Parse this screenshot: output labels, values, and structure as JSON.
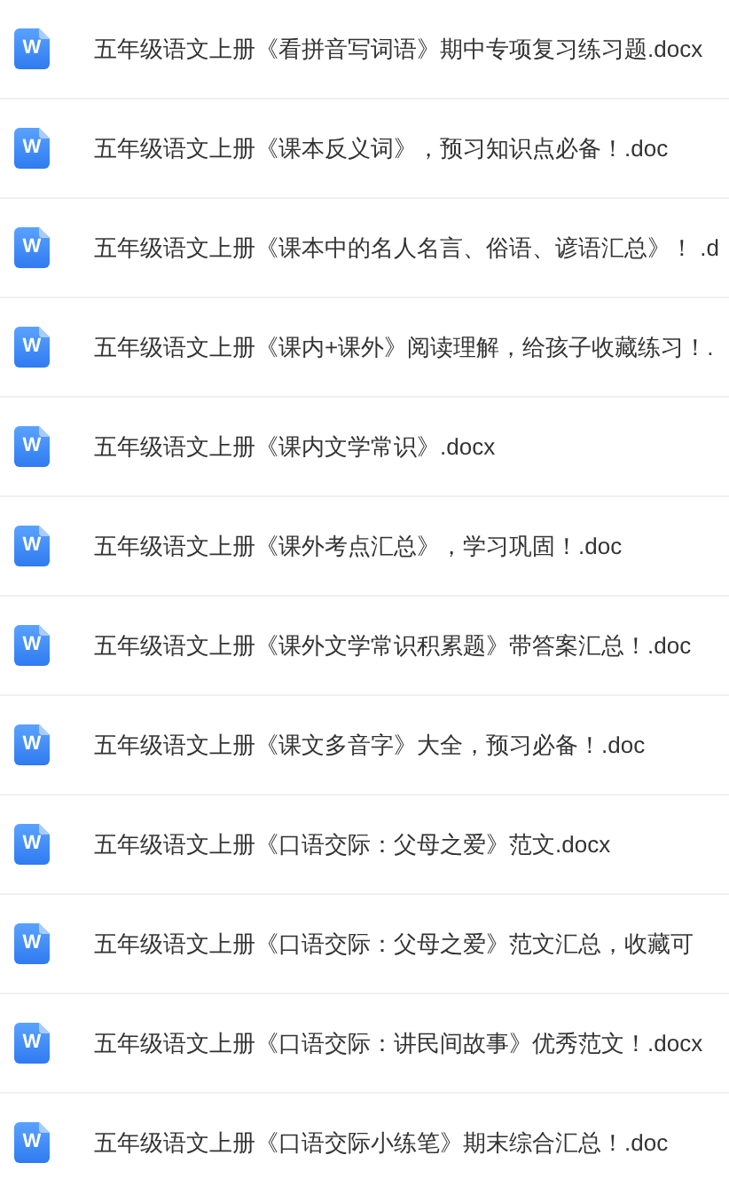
{
  "files": [
    {
      "name": "五年级语文上册《看拼音写词语》期中专项复习练习题.docx",
      "icon_label": "W"
    },
    {
      "name": "五年级语文上册《课本反义词》，预习知识点必备！.doc",
      "icon_label": "W"
    },
    {
      "name": "五年级语文上册《课本中的名人名言、俗语、谚语汇总》！ .d",
      "icon_label": "W"
    },
    {
      "name": "五年级语文上册《课内+课外》阅读理解，给孩子收藏练习！.",
      "icon_label": "W"
    },
    {
      "name": "五年级语文上册《课内文学常识》.docx",
      "icon_label": "W"
    },
    {
      "name": "五年级语文上册《课外考点汇总》，学习巩固！.doc",
      "icon_label": "W"
    },
    {
      "name": "五年级语文上册《课外文学常识积累题》带答案汇总！.doc",
      "icon_label": "W"
    },
    {
      "name": "五年级语文上册《课文多音字》大全，预习必备！.doc",
      "icon_label": "W"
    },
    {
      "name": "五年级语文上册《口语交际：父母之爱》范文.docx",
      "icon_label": "W"
    },
    {
      "name": "五年级语文上册《口语交际：父母之爱》范文汇总，收藏可",
      "icon_label": "W"
    },
    {
      "name": "五年级语文上册《口语交际：讲民间故事》优秀范文！.docx",
      "icon_label": "W"
    },
    {
      "name": "五年级语文上册《口语交际小练笔》期末综合汇总！.doc",
      "icon_label": "W"
    }
  ]
}
